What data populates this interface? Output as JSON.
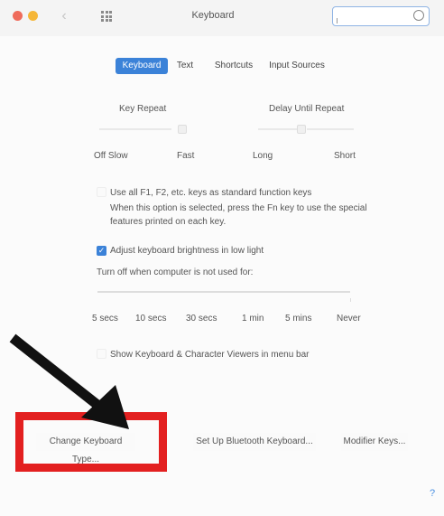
{
  "window": {
    "title": "Keyboard",
    "search_placeholder": "",
    "back_icon": "chevron-left-icon",
    "grid_icon": "show-all-grid-icon"
  },
  "tabs": [
    {
      "label": "Keyboard",
      "active": true
    },
    {
      "label": "Text",
      "active": false
    },
    {
      "label": "Shortcuts",
      "active": false
    },
    {
      "label": "Input Sources",
      "active": false
    }
  ],
  "key_repeat": {
    "title": "Key Repeat",
    "left_label": "Off Slow",
    "right_label": "Fast"
  },
  "delay_until_repeat": {
    "title": "Delay Until Repeat",
    "left_label": "Long",
    "right_label": "Short"
  },
  "fn_keys": {
    "label": "Use all F1, F2, etc. keys as standard function keys",
    "checked": false,
    "note_line1": "When this option is selected, press the Fn key to use the special",
    "note_line2": "features printed on each key."
  },
  "brightness": {
    "label": "Adjust keyboard brightness in low light",
    "checked": true,
    "turnoff_label": "Turn off when computer is not used for:",
    "ticks": [
      "5 secs",
      "10 secs",
      "30 secs",
      "1 min",
      "5 mins",
      "Never"
    ]
  },
  "viewers": {
    "label": "Show Keyboard & Character Viewers in menu bar",
    "checked": false
  },
  "buttons": {
    "change_type": "Change Keyboard Type...",
    "bluetooth": "Set Up Bluetooth Keyboard...",
    "modifier": "Modifier Keys..."
  },
  "help": "?",
  "annotation_color": "#e32020",
  "accent_color": "#3b82d8"
}
